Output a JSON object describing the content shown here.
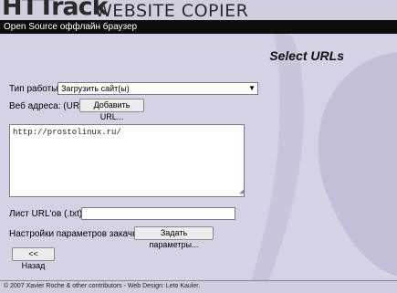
{
  "header": {
    "logo_main": "HTTrack",
    "logo_sub": "WEBSITE COPIER",
    "tagline": "Open Source оффлайн браузер"
  },
  "page": {
    "title": "Select URLs"
  },
  "form": {
    "work_type_label": "Тип работы:",
    "work_type_value": "Загрузить сайт(ы)",
    "web_address_label": "Веб адреса: (URL)",
    "add_url_button": "Добавить URL...",
    "url_text": "http://prostolinux.ru/",
    "url_list_label": "Лист URL'ов (.txt):",
    "url_list_value": "",
    "settings_label": "Настройки параметров закачки::",
    "settings_button": "Задать параметры...",
    "back_button": "<< Назад"
  },
  "footer": {
    "text": "© 2007 Xavier Roche & other contributors - Web Design: Leto Kauler."
  },
  "colors": {
    "background": "#d4d2e4",
    "topbar": "#0d0d0d",
    "accent_shape": "#c2c0d8"
  }
}
